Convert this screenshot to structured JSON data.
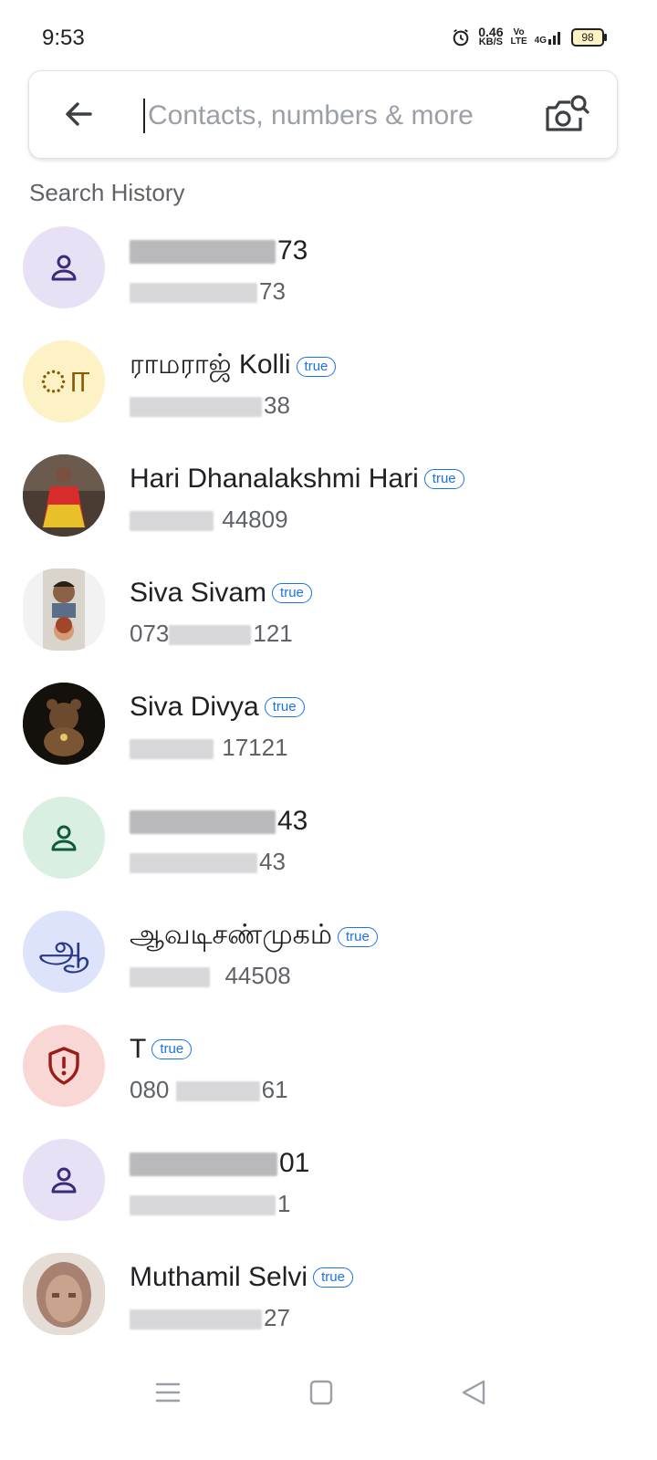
{
  "status_bar": {
    "time": "9:53",
    "speed_value": "0.46",
    "speed_unit": "KB/S",
    "volte_top": "Vo",
    "volte_bottom": "LTE",
    "network": "4G",
    "battery": "98"
  },
  "search": {
    "placeholder": "Contacts, numbers & more"
  },
  "history_heading": "Search History",
  "contacts": [
    {
      "name_visible": "73",
      "number_visible": "73",
      "avatar": "person-icon",
      "avatar_bg": "#e8e1f6",
      "avatar_fg": "#3c2a7a"
    },
    {
      "name": "ராமராஜ் Kolli",
      "badge": "true",
      "number_visible": "38",
      "avatar_letter": "ா",
      "avatar_bg": "#fdf1c6",
      "avatar_fg": "#8a5a00"
    },
    {
      "name": "Hari Dhanalakshmi Hari",
      "badge": "true",
      "number_visible": "44809",
      "avatar": "photo"
    },
    {
      "name": "Siva Sivam",
      "badge": "true",
      "number_prefix": "073",
      "number_visible": "121",
      "avatar": "photo"
    },
    {
      "name": "Siva Divya",
      "badge": "true",
      "number_visible": "17121",
      "avatar": "photo"
    },
    {
      "name_visible": "43",
      "number_visible": "43",
      "avatar": "person-icon",
      "avatar_bg": "#d8efe2",
      "avatar_fg": "#0f5a3a"
    },
    {
      "name": "ஆவடிசண்முகம்",
      "badge": "true",
      "number_visible": "44508",
      "avatar_letter": "ஆ",
      "avatar_bg": "#dde3fb",
      "avatar_fg": "#2a3a8a"
    },
    {
      "name": "T",
      "badge": "true",
      "number_prefix": "080",
      "number_visible": "61",
      "avatar": "shield-icon",
      "avatar_bg": "#f8d7d5",
      "avatar_fg": "#9b1c16"
    },
    {
      "name_visible": "01",
      "number_visible": "1",
      "avatar": "person-icon",
      "avatar_bg": "#e8e1f6",
      "avatar_fg": "#3c2a7a"
    },
    {
      "name": "Muthamil Selvi",
      "badge": "true",
      "number_visible": "27",
      "avatar": "photo"
    }
  ]
}
